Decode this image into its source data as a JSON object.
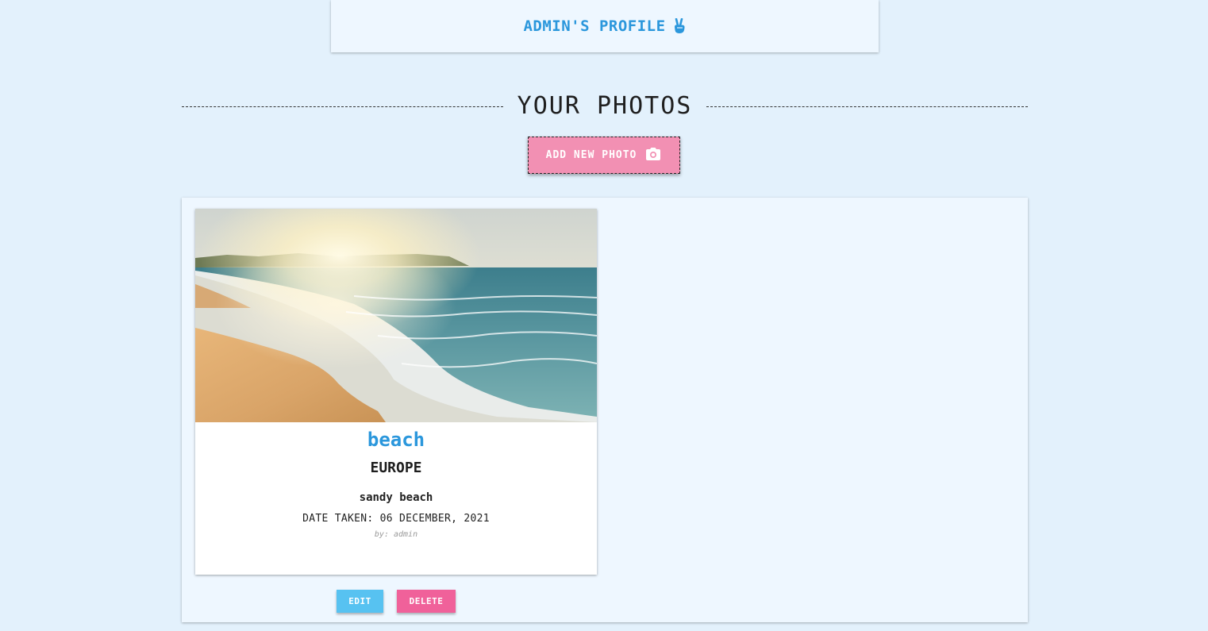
{
  "profile": {
    "title": "ADMIN'S PROFILE",
    "icon": "peace-hand-icon"
  },
  "section": {
    "heading": "YOUR PHOTOS"
  },
  "add_photo": {
    "label": "ADD NEW PHOTO",
    "icon": "camera-icon"
  },
  "photos": [
    {
      "title": "beach",
      "location": "EUROPE",
      "description": "sandy beach",
      "date": "DATE TAKEN: 06 DECEMBER, 2021",
      "author": "by: admin",
      "edit_label": "EDIT",
      "delete_label": "DELETE"
    }
  ],
  "colors": {
    "background": "#e3f1fc",
    "accent_blue": "#2b97dc",
    "add_button": "#f290b3",
    "edit_button": "#57c2f1",
    "delete_button": "#f0619a"
  }
}
